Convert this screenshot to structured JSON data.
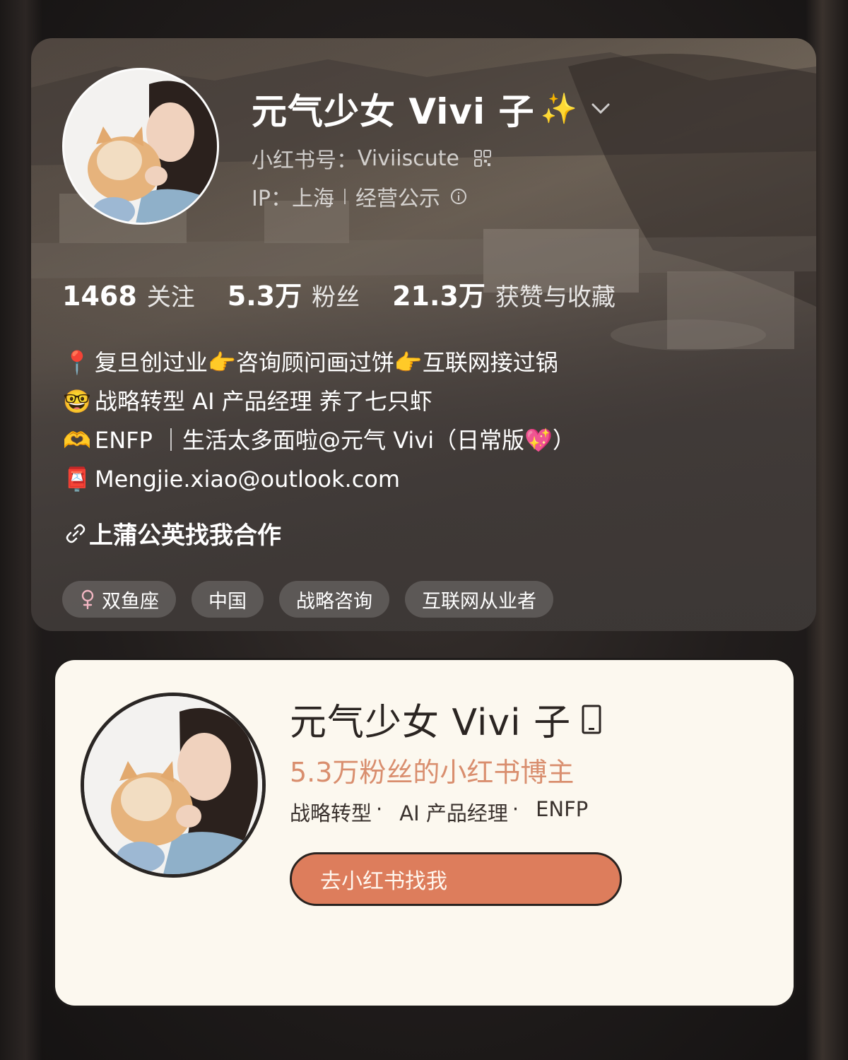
{
  "profile": {
    "nickname": "元气少女 Vivi 子",
    "sparkle": "✨",
    "id_label": "小红书号：",
    "id_value": "Viviiscute",
    "ip_label": "IP：",
    "ip_value": "上海",
    "business": "经营公示"
  },
  "stats": [
    {
      "value": "1468",
      "label": "关注"
    },
    {
      "value": "5.3万",
      "label": "粉丝"
    },
    {
      "value": "21.3万",
      "label": "获赞与收藏"
    }
  ],
  "bio": {
    "line1": {
      "emoji": "📍",
      "text": "复旦创过业👉咨询顾问画过饼👉互联网接过锅"
    },
    "line2": {
      "emoji": "🤓",
      "text": "战略转型 AI 产品经理 养了七只虾"
    },
    "line3": {
      "emoji": "🫶",
      "text": "ENFP ｜生活太多面啦@元气 Vivi（日常版💖）"
    },
    "line4": {
      "emoji": "📮",
      "text": "Mengjie.xiao@outlook.com"
    }
  },
  "link": {
    "text": "上蒲公英找我合作"
  },
  "tags": [
    {
      "label": "双鱼座",
      "icon": "female-icon"
    },
    {
      "label": "中国"
    },
    {
      "label": "战略咨询"
    },
    {
      "label": "互联网从业者"
    }
  ],
  "share": {
    "name": "元气少女 Vivi 子",
    "subtitle": "5.3万粉丝的小红书博主",
    "tags": [
      "战略转型",
      "AI 产品经理",
      "ENFP"
    ],
    "button": "去小红书找我"
  },
  "colors": {
    "accent_orange": "#dd7d5c",
    "subtitle_orange": "#d98e6e",
    "share_bg": "#fcf8ef"
  }
}
